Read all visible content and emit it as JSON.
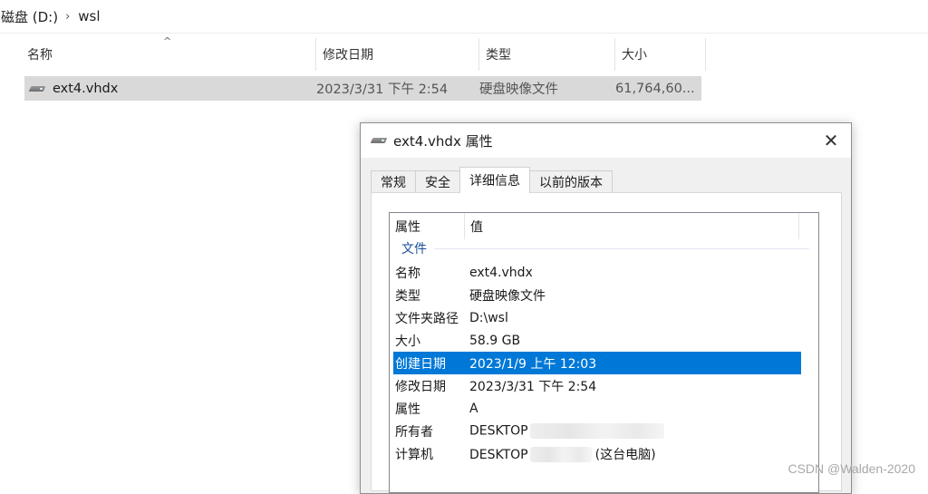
{
  "breadcrumb": {
    "items": [
      "磁盘 (D:)",
      "wsl"
    ],
    "separator": "›"
  },
  "file_list": {
    "columns": [
      "名称",
      "修改日期",
      "类型",
      "大小"
    ],
    "sort_caret": "^",
    "rows": [
      {
        "name": "ext4.vhdx",
        "modified": "2023/3/31 下午 2:54",
        "type": "硬盘映像文件",
        "size": "61,764,60..."
      }
    ]
  },
  "dialog": {
    "title": "ext4.vhdx 属性",
    "close_glyph": "✕",
    "tabs": [
      "常规",
      "安全",
      "详细信息",
      "以前的版本"
    ],
    "active_tab": "详细信息",
    "columns": [
      "属性",
      "值"
    ],
    "group": "文件",
    "props": [
      {
        "key": "名称",
        "value": "ext4.vhdx"
      },
      {
        "key": "类型",
        "value": "硬盘映像文件"
      },
      {
        "key": "文件夹路径",
        "value": "D:\\wsl"
      },
      {
        "key": "大小",
        "value": "58.9 GB"
      },
      {
        "key": "创建日期",
        "value": "2023/1/9 上午 12:03"
      },
      {
        "key": "修改日期",
        "value": "2023/3/31 下午 2:54"
      },
      {
        "key": "属性",
        "value": "A"
      },
      {
        "key": "所有者",
        "value": "DESKTOP"
      },
      {
        "key": "计算机",
        "value": "DESKTOP",
        "suffix": "(这台电脑)"
      }
    ],
    "selected_row": "创建日期"
  },
  "watermark": "CSDN @Walden-2020",
  "colors": {
    "selection": "#0078d7",
    "group_label": "#1c4d9e",
    "row_highlight": "#d9d9d9"
  }
}
